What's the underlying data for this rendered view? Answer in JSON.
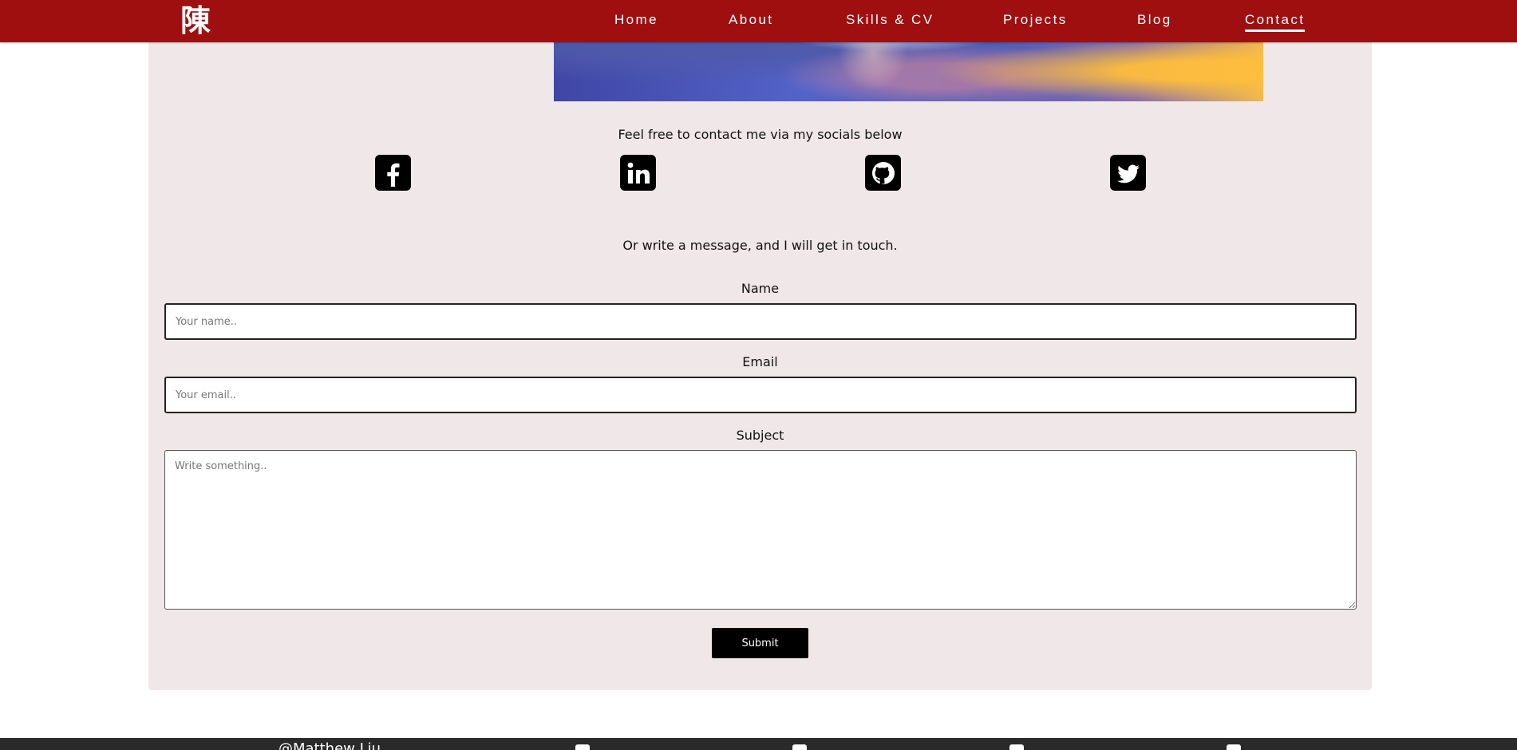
{
  "nav": {
    "logo": "陳",
    "items": [
      {
        "label": "Home"
      },
      {
        "label": "About"
      },
      {
        "label": "Skills & CV"
      },
      {
        "label": "Projects"
      },
      {
        "label": "Blog"
      },
      {
        "label": "Contact",
        "active": true
      }
    ]
  },
  "contact": {
    "socials_intro": "Feel free to contact me via my socials below",
    "socials": [
      {
        "icon": "facebook-icon"
      },
      {
        "icon": "linkedin-icon"
      },
      {
        "icon": "github-icon"
      },
      {
        "icon": "twitter-icon"
      }
    ],
    "message_intro": "Or write a message, and I will get in touch.",
    "name_label": "Name",
    "name_placeholder": "Your name..",
    "email_label": "Email",
    "email_placeholder": "Your email..",
    "subject_label": "Subject",
    "subject_placeholder": "Write something..",
    "submit_label": "Submit"
  },
  "footer": {
    "copyright": "@Matthew Liu"
  },
  "colors": {
    "nav_bg": "#a00f10",
    "card_bg": "#f0e7e8",
    "footer_bg": "#2a2a2a"
  }
}
